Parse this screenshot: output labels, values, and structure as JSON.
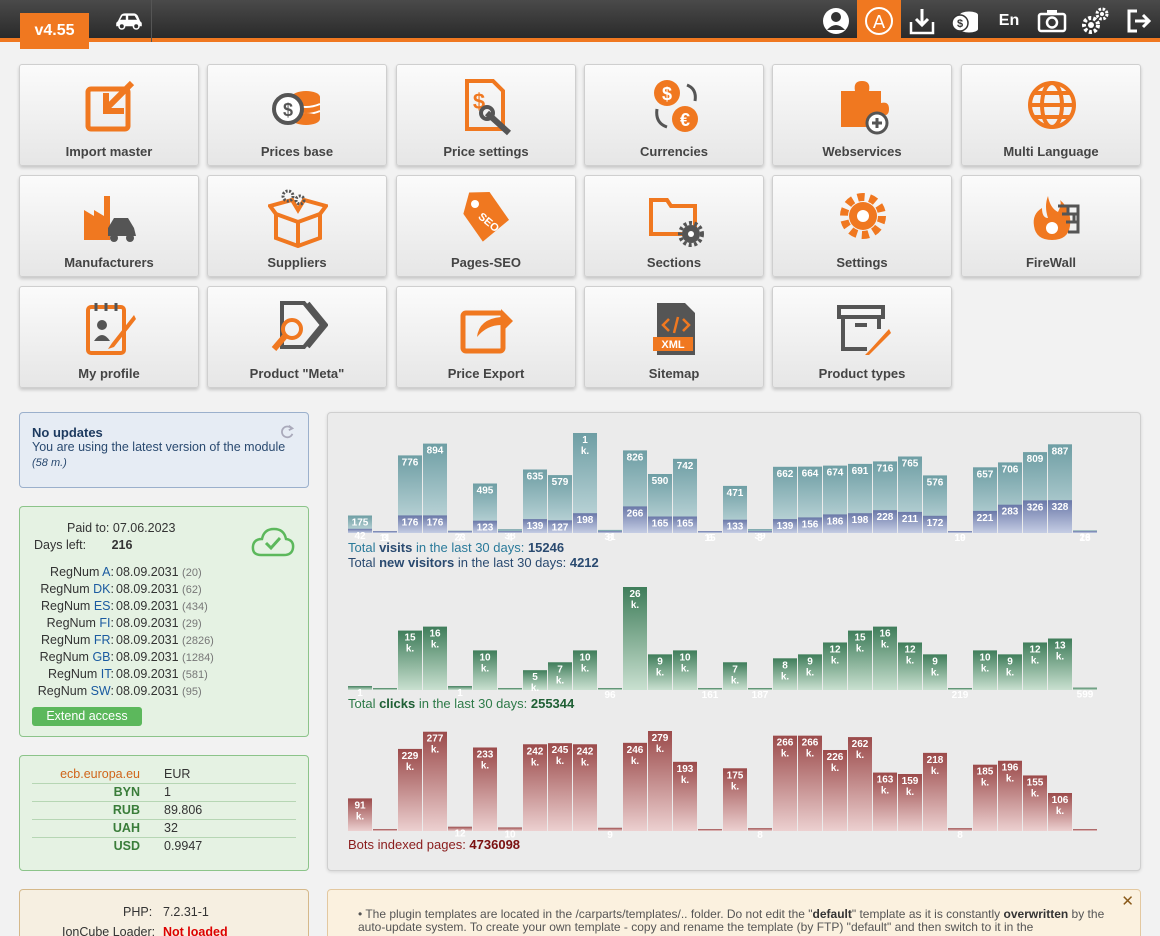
{
  "header": {
    "version": "v4.55",
    "language": "En",
    "icons": [
      "car-icon",
      "user-icon",
      "admin-icon",
      "download-icon",
      "coins-icon",
      "camera-icon",
      "gears-icon",
      "logout-icon"
    ],
    "accent": "#f07820"
  },
  "modules": [
    {
      "label": "Import master",
      "icon": "import-icon"
    },
    {
      "label": "Prices base",
      "icon": "coins-icon"
    },
    {
      "label": "Price settings",
      "icon": "price-settings-icon"
    },
    {
      "label": "Currencies",
      "icon": "currency-exchange-icon"
    },
    {
      "label": "Webservices",
      "icon": "puzzle-icon"
    },
    {
      "label": "Multi Language",
      "icon": "globe-icon"
    },
    {
      "label": "Manufacturers",
      "icon": "factory-icon"
    },
    {
      "label": "Suppliers",
      "icon": "box-icon"
    },
    {
      "label": "Pages-SEO",
      "icon": "seo-tag-icon"
    },
    {
      "label": "Sections",
      "icon": "folder-gear-icon"
    },
    {
      "label": "Settings",
      "icon": "gear-icon"
    },
    {
      "label": "FireWall",
      "icon": "firewall-icon"
    },
    {
      "label": "My profile",
      "icon": "profile-icon"
    },
    {
      "label": "Product \"Meta\"",
      "icon": "meta-tag-icon"
    },
    {
      "label": "Price Export",
      "icon": "export-icon"
    },
    {
      "label": "Sitemap",
      "icon": "xml-file-icon"
    },
    {
      "label": "Product types",
      "icon": "archive-edit-icon"
    }
  ],
  "update": {
    "title": "No updates",
    "message": "You are using the latest version of the module",
    "age": "(58 m.)"
  },
  "license": {
    "paid_label": "Paid to:",
    "paid_to": "07.06.2023",
    "days_label": "Days left:",
    "days_left": "216",
    "regs": [
      {
        "code": "A",
        "date": "08.09.2031",
        "count": "(20)"
      },
      {
        "code": "DK",
        "date": "08.09.2031",
        "count": "(62)"
      },
      {
        "code": "ES",
        "date": "08.09.2031",
        "count": "(434)"
      },
      {
        "code": "FI",
        "date": "08.09.2031",
        "count": "(29)"
      },
      {
        "code": "FR",
        "date": "08.09.2031",
        "count": "(2826)"
      },
      {
        "code": "GB",
        "date": "08.09.2031",
        "count": "(1284)"
      },
      {
        "code": "IT",
        "date": "08.09.2031",
        "count": "(581)"
      },
      {
        "code": "SW",
        "date": "08.09.2031",
        "count": "(95)"
      }
    ],
    "reg_prefix": "RegNum",
    "extend": "Extend access"
  },
  "currencies": {
    "source": "ecb.europa.eu",
    "base": "EUR",
    "rates": [
      {
        "code": "BYN",
        "value": "1"
      },
      {
        "code": "RUB",
        "value": "89.806"
      },
      {
        "code": "UAH",
        "value": "32"
      },
      {
        "code": "USD",
        "value": "0.9947"
      }
    ]
  },
  "server": {
    "php_label": "PHP:",
    "php": "7.2.31-1",
    "ioncube_label": "IonCube Loader:",
    "ioncube": "Not loaded"
  },
  "stats": {
    "visits_pre": "Total ",
    "visits_kw": "visits",
    "visits_post": " in the last 30 days: ",
    "visits_total": "15246",
    "new_pre": "Total ",
    "new_kw": "new visitors",
    "new_post": " in the last 30 days: ",
    "new_total": "4212",
    "clicks_pre": "Total ",
    "clicks_kw": "clicks",
    "clicks_post": " in the last 30 days: ",
    "clicks_total": "255344",
    "bots_label": "Bots indexed pages: ",
    "bots_total": "4736098"
  },
  "chart_data": [
    {
      "type": "bar",
      "series": [
        {
          "name": "visits",
          "values": [
            175,
            11,
            776,
            894,
            23,
            495,
            38,
            635,
            579,
            1000,
            31,
            826,
            590,
            742,
            15,
            471,
            39,
            662,
            664,
            674,
            691,
            716,
            765,
            576,
            19,
            657,
            706,
            809,
            887,
            26
          ],
          "labels": [
            "175",
            "11",
            "776",
            "894",
            "23",
            "495",
            "38",
            "635",
            "579",
            "1 k.",
            "31",
            "826",
            "590",
            "742",
            "15",
            "471",
            "39",
            "662",
            "664",
            "674",
            "691",
            "716",
            "765",
            "576",
            "19",
            "657",
            "706",
            "809",
            "887",
            "26"
          ]
        },
        {
          "name": "new visitors",
          "values": [
            42,
            3,
            176,
            176,
            7,
            123,
            4,
            139,
            127,
            198,
            8,
            266,
            165,
            165,
            6,
            133,
            3,
            139,
            156,
            186,
            198,
            228,
            211,
            172,
            10,
            221,
            283,
            326,
            328,
            13
          ]
        }
      ]
    },
    {
      "type": "bar",
      "series": [
        {
          "name": "clicks",
          "values": [
            1,
            0,
            15,
            16,
            1,
            10,
            0,
            5,
            7,
            10,
            0,
            26,
            9,
            10,
            0.16,
            7,
            0.18,
            8,
            9,
            12,
            15,
            16,
            12,
            9,
            0.22,
            10,
            9,
            12,
            13,
            0.6
          ],
          "labels": [
            "1 k.",
            "",
            "15 k.",
            "16 k.",
            "1 k.",
            "10 k.",
            "",
            "5 k.",
            "7 k.",
            "10 k.",
            "96",
            "26 k.",
            "9 k.",
            "10 k.",
            "161",
            "7 k.",
            "187",
            "8 k.",
            "9 k.",
            "12 k.",
            "15 k.",
            "16 k.",
            "12 k.",
            "9 k.",
            "219",
            "10 k.",
            "9 k.",
            "12 k.",
            "13 k.",
            "599"
          ]
        }
      ]
    },
    {
      "type": "bar",
      "series": [
        {
          "name": "bots",
          "values": [
            91,
            2,
            229,
            277,
            12,
            233,
            10,
            242,
            245,
            242,
            9,
            246,
            279,
            193,
            2,
            175,
            8,
            266,
            266,
            226,
            262,
            163,
            159,
            218,
            8,
            185,
            196,
            155,
            106,
            4
          ],
          "labels": [
            "91 k.",
            "",
            "229 k.",
            "277 k.",
            "12",
            "233 k.",
            "10",
            "242 k.",
            "245 k.",
            "242 k.",
            "9",
            "246 k.",
            "279 k.",
            "193 k.",
            "",
            "175 k.",
            "8",
            "266 k.",
            "266 k.",
            "226 k.",
            "262 k.",
            "163 k.",
            "159 k.",
            "218 k.",
            "8",
            "185 k.",
            "196 k.",
            "155 k.",
            "106 k.",
            ""
          ]
        }
      ]
    }
  ],
  "note": {
    "t1": "The plugin templates are located in the /carparts/templates/.. folder. Do not edit the \"",
    "b1": "default",
    "t2": "\" template as it is constantly ",
    "b2": "overwritten",
    "t3": " by the auto-update system. To create your own template - copy and rename the template (by FTP) \"default\" and then switch to it in the"
  }
}
